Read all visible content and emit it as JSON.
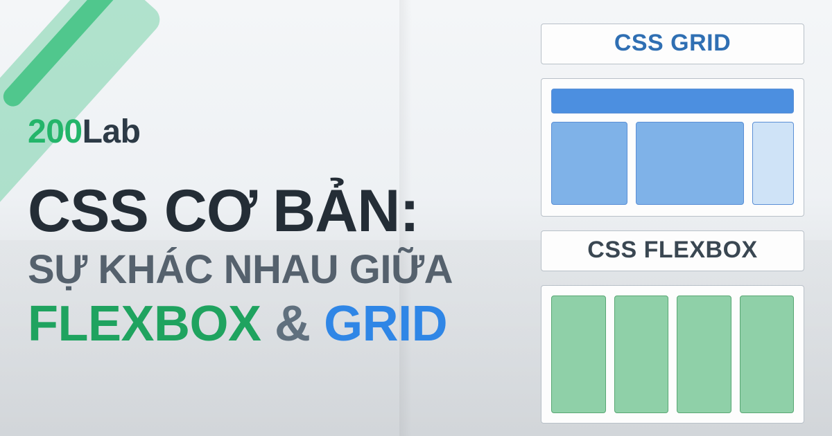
{
  "brand": {
    "part1": "200",
    "part2": "Lab"
  },
  "title": {
    "line1": "CSS CƠ BẢN:",
    "line2": "SỰ KHÁC NHAU GIỮA",
    "line3": {
      "flexbox": "FLEXBOX",
      "amp": "&",
      "grid": "GRID"
    }
  },
  "cards": {
    "grid_label": "CSS GRID",
    "flex_label": "CSS FLEXBOX"
  },
  "colors": {
    "brand_green": "#23b56a",
    "accent_green": "#1fa35f",
    "accent_blue": "#2f86e6",
    "grid_blue_dark": "#4c8fe0",
    "grid_blue_mid": "#7fb2e8",
    "grid_blue_light": "#cfe3f7",
    "flex_green": "#8fd0a8"
  }
}
